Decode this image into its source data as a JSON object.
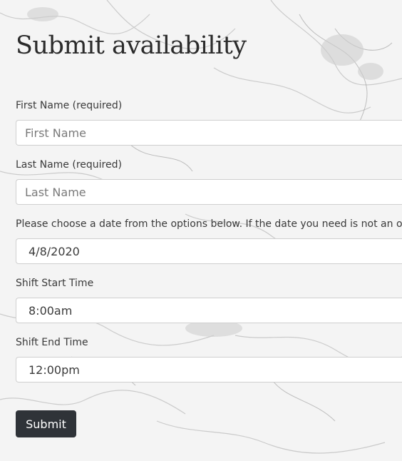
{
  "form": {
    "title": "Submit availability",
    "first_name": {
      "label": "First Name (required)",
      "placeholder": "First Name"
    },
    "last_name": {
      "label": "Last Name (required)",
      "placeholder": "Last Name"
    },
    "date": {
      "label": "Please choose a date from the options below. If the date you need is not an op",
      "selected": "4/8/2020"
    },
    "shift_start": {
      "label": "Shift Start Time",
      "selected": "8:00am"
    },
    "shift_end": {
      "label": "Shift End Time",
      "selected": "12:00pm"
    },
    "submit_label": "Submit"
  },
  "colors": {
    "button_bg": "#2f3338",
    "background": "#f3f3f3"
  }
}
